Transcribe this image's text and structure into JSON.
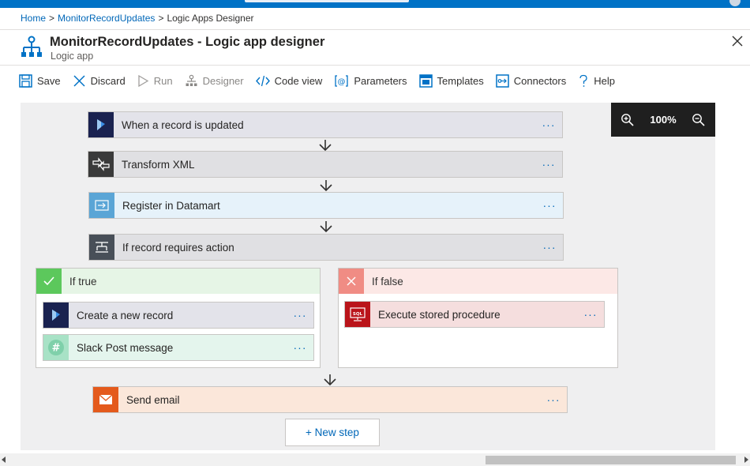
{
  "breadcrumb": {
    "home": "Home",
    "resource": "MonitorRecordUpdates",
    "current": "Logic Apps Designer",
    "separator": ">"
  },
  "header": {
    "title": "MonitorRecordUpdates - Logic app designer",
    "subtitle": "Logic app"
  },
  "toolbar": {
    "save": "Save",
    "discard": "Discard",
    "run": "Run",
    "designer": "Designer",
    "code_view": "Code view",
    "parameters": "Parameters",
    "templates": "Templates",
    "connectors": "Connectors",
    "help": "Help"
  },
  "zoom": {
    "level": "100%"
  },
  "steps": [
    {
      "label": "When a record is updated",
      "more": "···"
    },
    {
      "label": "Transform XML",
      "more": "···"
    },
    {
      "label": "Register in Datamart",
      "more": "···"
    },
    {
      "label": "If record requires action",
      "more": "···"
    }
  ],
  "condition": {
    "true_branch": {
      "label": "If true",
      "actions": [
        {
          "label": "Create a new record",
          "more": "···"
        },
        {
          "label": "Slack Post message",
          "more": "···"
        }
      ]
    },
    "false_branch": {
      "label": "If false",
      "actions": [
        {
          "label": "Execute stored procedure",
          "more": "···"
        }
      ]
    }
  },
  "final_step": {
    "label": "Send email",
    "more": "···"
  },
  "new_step": "+ New step",
  "colors": {
    "accent": "#0072c6",
    "link": "#0067b8",
    "dynamics": "#002050",
    "transform": "#3a3a3a",
    "datamart": "#5aa5d6",
    "condition": "#484f58",
    "true": "#5cc85c",
    "false": "#f08c84",
    "sql": "#ba141a",
    "slack": "#7fd0aa",
    "email": "#e45a1c"
  }
}
